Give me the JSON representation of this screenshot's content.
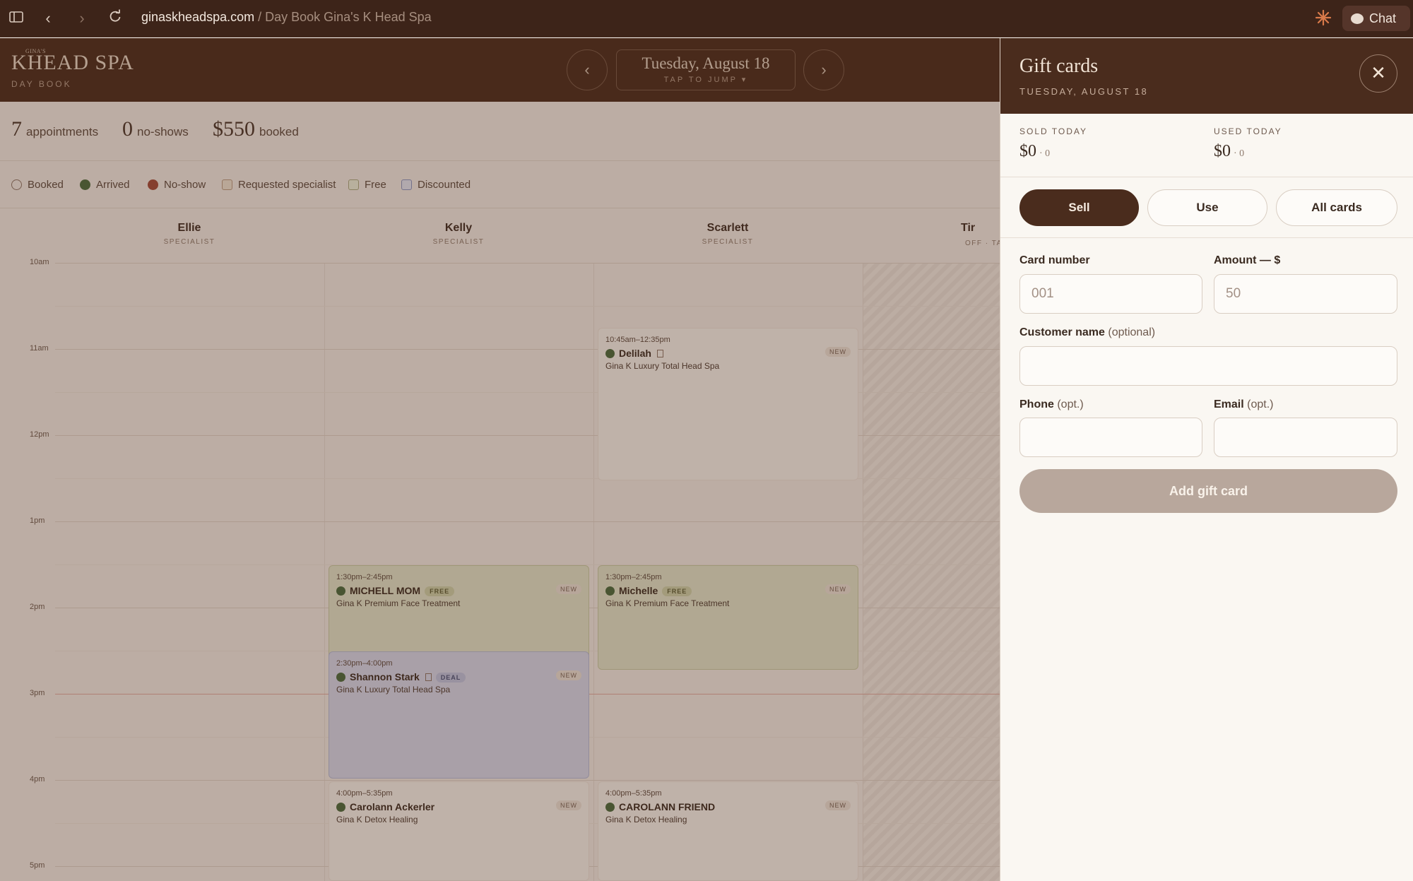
{
  "browser": {
    "host": "ginaskheadspa.com",
    "path": " / Day Book Gina's K Head Spa",
    "chat_label": "Chat"
  },
  "app": {
    "logo_small": "GINA'S",
    "logo_main": "KHEAD SPA",
    "logo_sub": "DAY BOOK",
    "date": "Tuesday, August 18",
    "tap_to_jump": "TAP TO JUMP ▾",
    "prev_label": "‹",
    "next_label": "›"
  },
  "stats": [
    {
      "number": "7",
      "label": "appointments"
    },
    {
      "number": "0",
      "label": "no-shows"
    },
    {
      "number": "$550",
      "label": "booked"
    }
  ],
  "legend": [
    "Booked",
    "Arrived",
    "No-show",
    "Requested specialist",
    "Free",
    "Discounted"
  ],
  "staff": [
    {
      "name": "Ellie",
      "role": "SPECIALIST"
    },
    {
      "name": "Kelly",
      "role": "SPECIALIST"
    },
    {
      "name": "Scarlett",
      "role": "SPECIALIST"
    },
    {
      "name": "Tir",
      "role": "OFF · TA"
    }
  ],
  "hours": [
    "10am",
    "11am",
    "12pm",
    "1pm",
    "2pm",
    "3pm",
    "4pm",
    "5pm"
  ],
  "appointments": [
    {
      "time": "10:45am–12:35pm",
      "name": "Delilah",
      "tag": "",
      "badge": "NEW",
      "service": "Gina K Luxury Total Head Spa"
    },
    {
      "time": "1:30pm–2:45pm",
      "name": "MICHELL MOM",
      "tag": "FREE",
      "badge": "NEW",
      "service": "Gina K Premium Face Treatment"
    },
    {
      "time": "1:30pm–2:45pm",
      "name": "Michelle",
      "tag": "FREE",
      "badge": "NEW",
      "service": "Gina K Premium Face Treatment"
    },
    {
      "time": "2:30pm–4:00pm",
      "name": "Shannon Stark",
      "tag": "DEAL",
      "badge": "NEW",
      "service": "Gina K Luxury Total Head Spa"
    },
    {
      "time": "4:00pm–5:35pm",
      "name": "Carolann Ackerler",
      "tag": "",
      "badge": "NEW",
      "service": "Gina K Detox Healing"
    },
    {
      "time": "4:00pm–5:35pm",
      "name": "CAROLANN FRIEND",
      "tag": "",
      "badge": "NEW",
      "service": "Gina K Detox Healing"
    }
  ],
  "panel": {
    "title": "Gift cards",
    "subtitle": "TUESDAY, AUGUST 18",
    "close_label": "✕",
    "sold_label": "SOLD TODAY",
    "sold_value": "$0",
    "sold_count": "· 0",
    "used_label": "USED TODAY",
    "used_value": "$0",
    "used_count": "· 0",
    "tabs": [
      "Sell",
      "Use",
      "All cards"
    ],
    "active_tab": "Sell",
    "card_number_label": "Card number",
    "card_number_placeholder": "001",
    "amount_label": "Amount — $",
    "amount_placeholder": "50",
    "customer_label": "Customer name",
    "customer_opt": " (optional)",
    "phone_label": "Phone",
    "phone_opt": " (opt.)",
    "email_label": "Email",
    "email_opt": " (opt.)",
    "submit_label": "Add gift card"
  },
  "colors": {
    "brand_dark": "#4a2c1d",
    "chrome": "#3d2419",
    "arrived_green": "#4a6b3e",
    "free_bg": "#e3e5cc",
    "deal_bg": "#d8d9ec",
    "disabled_button": "#b8a79c"
  }
}
